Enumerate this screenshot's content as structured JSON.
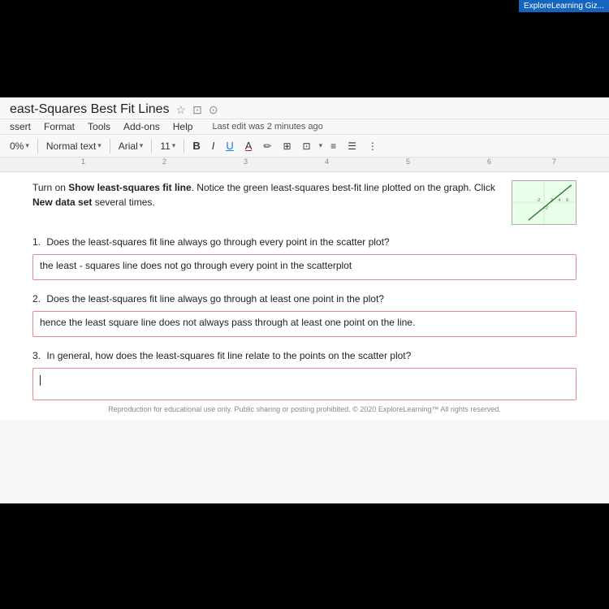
{
  "title": "east-Squares Best Fit Lines",
  "title_icons": [
    "star",
    "save",
    "cloud"
  ],
  "explore_badge": "ExploreLearning Giz...",
  "menu": {
    "items": [
      "ssert",
      "Format",
      "Tools",
      "Add-ons",
      "Help"
    ],
    "last_edit": "Last edit was 2 minutes ago"
  },
  "toolbar": {
    "zoom": "0%",
    "style": "Normal text",
    "font": "Arial",
    "size": "11",
    "bold": "B",
    "italic": "I",
    "underline": "U",
    "text_color": "A"
  },
  "ruler": {
    "marks": [
      "1",
      "2",
      "3",
      "4",
      "5",
      "6",
      "7"
    ]
  },
  "content": {
    "intro": "Turn on Show least-squares fit line. Notice the green least-squares best-fit line plotted on the graph. Click New data set several times.",
    "intro_bold": [
      "Show least-squares fit line",
      "New data set"
    ],
    "questions": [
      {
        "number": "1.",
        "text": "Does the least-squares fit line always go through every point in the scatter plot?",
        "answer": "the least - squares line does not go through every point in the scatterplot"
      },
      {
        "number": "2.",
        "text": "Does the least-squares fit line always go through at least one point in the plot?",
        "answer": "hence the least square line does not  always pass through at least one point on the line."
      },
      {
        "number": "3.",
        "text": "In general, how does the least-squares fit line relate to the points on the scatter plot?",
        "answer": ""
      }
    ],
    "footer": "Reproduction for educational use only. Public sharing or posting prohibited. © 2020 ExploreLearning™ All rights reserved."
  }
}
